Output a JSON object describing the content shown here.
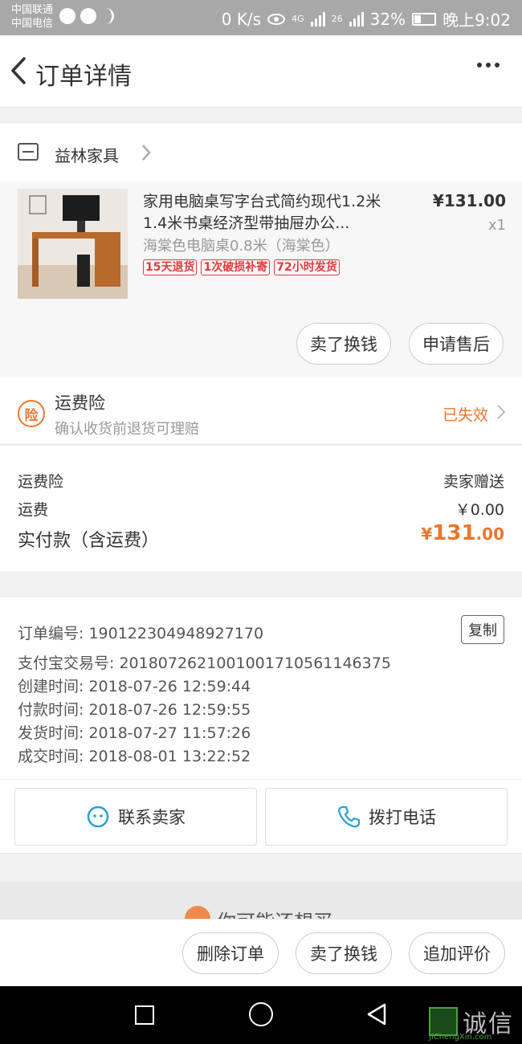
{
  "status_bar": {
    "carrier1": "中国联通",
    "carrier2": "中国电信",
    "speed": "0 K/s",
    "net1": "4G",
    "net2": "26",
    "battery": "32%",
    "time": "晚上9:02"
  },
  "header": {
    "title": "订单详情",
    "back_icon": "chevron-left-icon",
    "more_icon": "more-dots-icon"
  },
  "shop": {
    "name": "益林家具",
    "icon": "store-icon"
  },
  "product": {
    "title": "家用电脑桌写字台式简约现代1.2米 1.4米书桌经济型带抽屉办公...",
    "sku": "海棠色电脑桌0.8米（海棠色）",
    "tags": [
      "15天退货",
      "1次破损补寄",
      "72小时发货"
    ],
    "price": "¥131.00",
    "qty": "x1",
    "btn_resell": "卖了换钱",
    "btn_aftersale": "申请售后"
  },
  "insurance": {
    "icon_text": "险",
    "title": "运费险",
    "subtitle": "确认收货前退货可理赔",
    "status": "已失效"
  },
  "fees": {
    "ins_label": "运费险",
    "ins_value": "卖家赠送",
    "ship_label": "运费",
    "ship_value": "￥0.00",
    "paid_label": "实付款（含运费）",
    "paid_currency": "¥",
    "paid_int": "131",
    "paid_dec": ".00"
  },
  "order_info": {
    "order_no": "订单编号: 190122304948927170",
    "copy_label": "复制",
    "alipay_no": "支付宝交易号: 2018072621001001710561146375",
    "created": "创建时间: 2018-07-26 12:59:44",
    "paid": "付款时间: 2018-07-26 12:59:55",
    "shipped": "发货时间: 2018-07-27 11:57:26",
    "completed": "成交时间: 2018-08-01 13:22:52",
    "contact_seller": "联系卖家",
    "call_phone": "拨打电话"
  },
  "recommend": {
    "title": "你可能还想买"
  },
  "bottom_bar": {
    "delete": "删除订单",
    "resell": "卖了换钱",
    "review": "追加评价"
  },
  "watermark": {
    "text": "诚信",
    "sub": "JiChengXin.com"
  },
  "colors": {
    "accent_orange": "#e8772e",
    "tag_red": "#e4393c",
    "blue_icon": "#2a9fd8"
  }
}
